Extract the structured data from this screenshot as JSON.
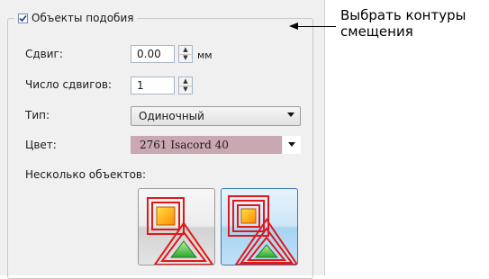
{
  "panel": {
    "group_title": "Объекты подобия",
    "group_checked": true,
    "offset_label": "Сдвиг:",
    "offset_value": "0.00",
    "offset_unit": "мм",
    "count_label": "Число сдвигов:",
    "count_value": "1",
    "type_label": "Тип:",
    "type_value": "Одиночный",
    "color_label": "Цвет:",
    "color_value": "2761 Isacord 40",
    "color_swatch": "#c9a8b1",
    "multi_label": "Несколько объектов:",
    "tiles": [
      {
        "name": "single-offset-option",
        "selected": false
      },
      {
        "name": "multiple-offset-option",
        "selected": true
      }
    ]
  },
  "callout": {
    "line1": "Выбрать контуры",
    "line2": "смещения"
  },
  "icons": {
    "check": "checkmark-icon",
    "spin_up": "spin-up-icon",
    "spin_down": "spin-down-icon",
    "dropdown": "chevron-down-icon",
    "offset_shape": "offset-outline-icon"
  }
}
